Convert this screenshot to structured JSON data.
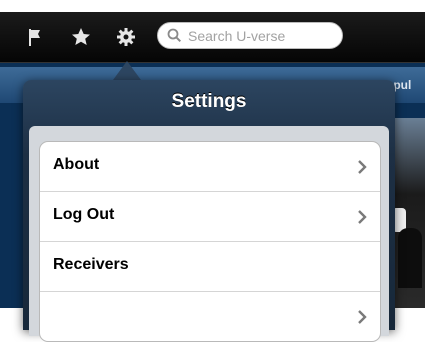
{
  "toolbar": {
    "icons": [
      "flag-icon",
      "star-icon",
      "gear-icon"
    ],
    "search": {
      "placeholder": "Search U-verse",
      "value": ""
    }
  },
  "background": {
    "tab_label": "Popul"
  },
  "settings": {
    "title": "Settings",
    "items": [
      {
        "label": "About",
        "has_chevron": true
      },
      {
        "label": "Log Out",
        "has_chevron": true
      },
      {
        "label": "Receivers",
        "has_chevron": false
      },
      {
        "label": "",
        "has_chevron": true
      }
    ]
  },
  "colors": {
    "toolbar_bg": "#0a0a0a",
    "popover_header": "#2c4560",
    "sheet_bg": "#d3d7dc"
  }
}
